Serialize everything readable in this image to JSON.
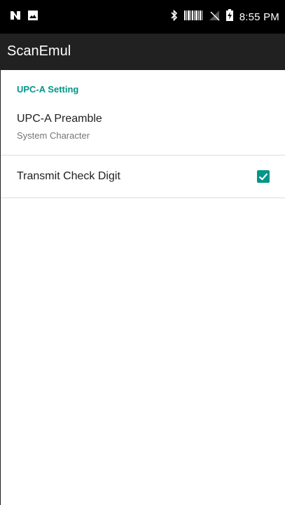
{
  "status_bar": {
    "time": "8:55 PM",
    "left_icons": [
      "n-logo-icon",
      "image-icon"
    ],
    "right_icons": [
      "bluetooth-icon",
      "barcode-icon",
      "no-signal-icon",
      "battery-charging-icon"
    ]
  },
  "app_bar": {
    "title": "ScanEmul"
  },
  "settings": {
    "category": "UPC-A Setting",
    "preamble": {
      "title": "UPC-A Preamble",
      "summary": "System Character"
    },
    "check_digit": {
      "title": "Transmit Check Digit",
      "checked": true
    }
  },
  "colors": {
    "accent": "#009688",
    "app_bar": "#212121",
    "status_bar": "#000000"
  }
}
